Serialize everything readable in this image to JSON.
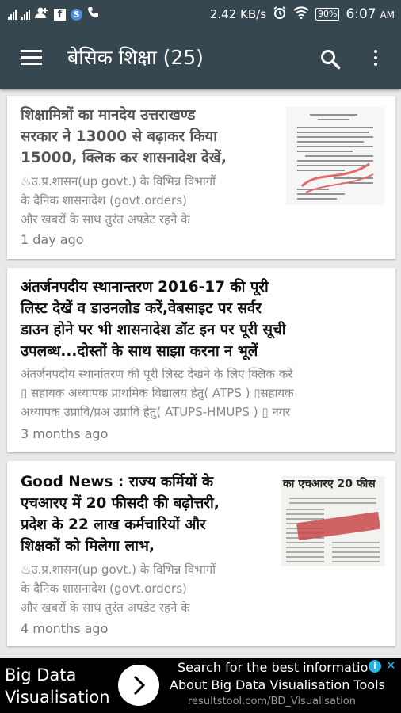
{
  "status_bar": {
    "net_speed": "2.42 KB/s",
    "battery": "90%",
    "time": "6:07",
    "ampm": "AM"
  },
  "app_bar": {
    "title": "बेसिक शिक्षा (25)"
  },
  "posts": [
    {
      "title_lines": [
        "शिक्षामित्रों का मानदेय उत्तराखण्ड",
        "सरकार ने 13000 से बढ़ाकर किया",
        "15000, क्लिक कर शासनादेश देखें,"
      ],
      "excerpt_lines": [
        "♨उ.प्र.शासन(up govt.) के विभिन्न विभागों",
        "के दैनिक शासनादेश (govt.orders)",
        "और खबरों के साथ तुरंत अपडेट रहने के"
      ],
      "time": "1 day ago"
    },
    {
      "title_lines": [
        "अंतर्जनपदीय स्थानान्तरण 2016-17 की पूरी",
        "लिस्ट देखें व डाउनलोड करें,वेबसाइट पर सर्वर",
        "डाउन होने पर भी शासनादेश डॉट इन पर पूरी सूची",
        "उपलब्ध...दोस्तों के साथ साझा करना न भूलें"
      ],
      "excerpt_lines": [
        "अंतर्जनपदीय  स्थानांतरण की पूरी लिस्ट देखने के लिए क्लिक करें",
        "▯ सहायक अध्यापक प्राथमिक विद्यालय हेतु( ATPS ) ▯सहायक",
        "अध्यापक उप्रावि/प्रअ  उप्रावि हेतु( ATUPS-HMUPS ) ▯ नगर"
      ],
      "time": "3 months ago"
    },
    {
      "title_lines": [
        "Good News : राज्य कर्मियों के",
        "एचआरए में 20 फीसदी की बढ़ोत्तरी,",
        "प्रदेश के 22 लाख कर्मचारियों और",
        "शिक्षकों को मिलेगा लाभ,"
      ],
      "excerpt_lines": [
        "♨उ.प्र.शासन(up govt.) के विभिन्न विभागों",
        "के दैनिक शासनादेश (govt.orders)",
        "और खबरों के साथ तुरंत अपडेट रहने के"
      ],
      "time": "4 months ago",
      "thumb_text": "का एचआरए 20 फीस"
    }
  ],
  "ad": {
    "brand_line1": "Big Data",
    "brand_line2": "Visualisation",
    "line1": "Search for the best informatio",
    "line2": "About Big Data Visualisation Tools",
    "url": "resultstool.com/BD_Visualisation"
  }
}
